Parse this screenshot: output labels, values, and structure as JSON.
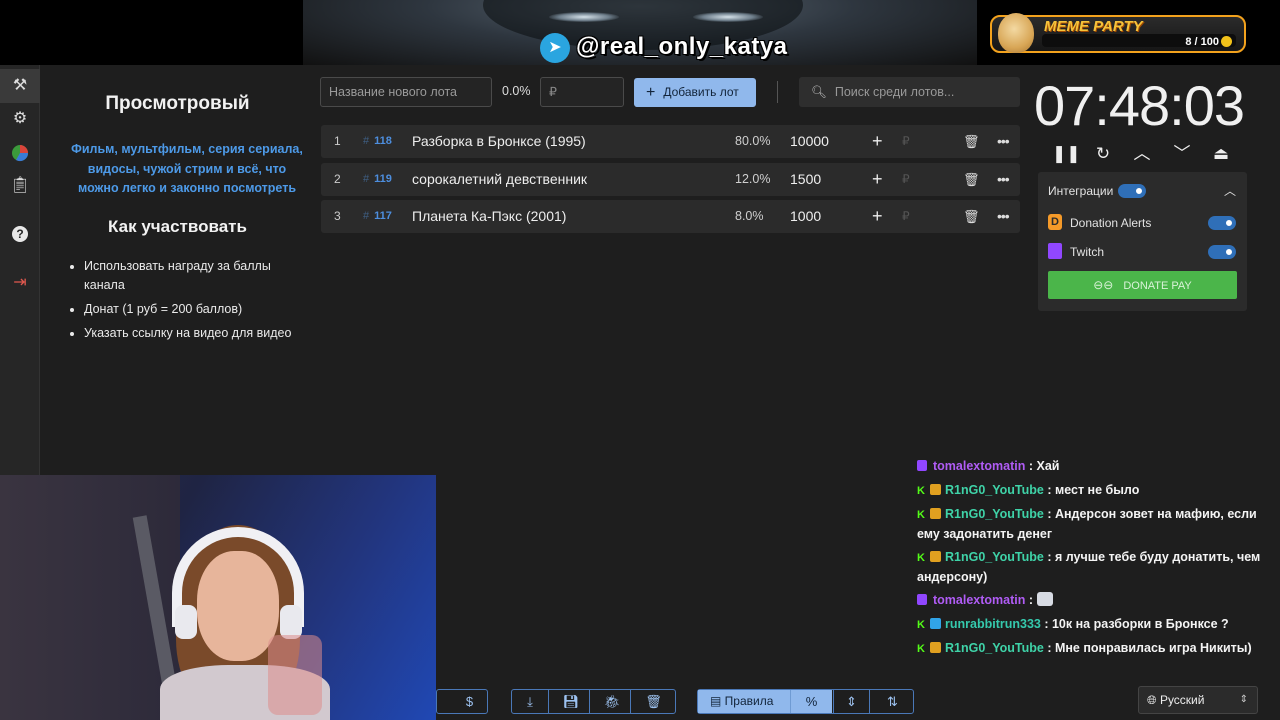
{
  "stream_overlay": {
    "telegram_handle": "@real_only_katya",
    "meme_party": {
      "title": "MEME PARTY",
      "progress_text": "8 / 100",
      "progress_value": 0.08
    }
  },
  "sidebar": {
    "icons": [
      "gavel-icon",
      "gear-icon",
      "wheel-icon",
      "clipboard-icon",
      "help-icon",
      "logout-icon"
    ],
    "active_index": 0
  },
  "info_panel": {
    "title": "Просмотровый",
    "description": "Фильм, мультфильм, серия сериала, видосы, чужой стрим и всё, что можно легко и законно посмотреть",
    "how_title": "Как участвовать",
    "bullets": [
      "Использовать награду за баллы канала",
      "Донат (1 руб = 200 баллов)",
      "Указать ссылку на видео для видео"
    ]
  },
  "toolbar": {
    "lot_name_placeholder": "Название нового лота",
    "percent": "0.0%",
    "amount_placeholder": "₽",
    "add_button": "Добавить лот",
    "search_placeholder": "Поиск среди лотов..."
  },
  "lots": [
    {
      "index": "1",
      "id": "118",
      "name": "Разборка в Бронксе (1995)",
      "percent": "80.0%",
      "amount": "10000"
    },
    {
      "index": "2",
      "id": "119",
      "name": "сорокалетний девственник",
      "percent": "12.0%",
      "amount": "1500"
    },
    {
      "index": "3",
      "id": "117",
      "name": "Планета Ка-Пэкс (2001)",
      "percent": "8.0%",
      "amount": "1000"
    }
  ],
  "timer": {
    "value": "07:48:03"
  },
  "integrations": {
    "label": "Интеграции",
    "enabled": true,
    "items": [
      {
        "name": "Donation Alerts",
        "enabled": true
      },
      {
        "name": "Twitch",
        "enabled": true
      }
    ],
    "donate_pay": "DONATE PAY"
  },
  "chat": [
    {
      "platform": "twitch",
      "user": "tomalextomatin",
      "text": "Хай"
    },
    {
      "platform": "kick",
      "user": "R1nG0_YouTube",
      "text": "мест не было"
    },
    {
      "platform": "kick",
      "user": "R1nG0_YouTube",
      "text": "Андерсон зовет на мафию, если ему задонатить денег"
    },
    {
      "platform": "kick",
      "user": "R1nG0_YouTube",
      "text": "я лучше тебе буду донатить, чем андерсону)"
    },
    {
      "platform": "twitch",
      "user": "tomalextomatin",
      "text": ""
    },
    {
      "platform": "kick",
      "user": "runrabbitrun333",
      "text": "10к на разборки в Бронксе ?"
    },
    {
      "platform": "kick",
      "user": "R1nG0_YouTube",
      "text": "Мне понравилась игра Никиты)"
    }
  ],
  "bottom_bar": {
    "rules_label": "Правила",
    "percent_label": "%",
    "language": "Русский"
  },
  "colors": {
    "accent": "#90b8ec",
    "background": "#1e1e1e",
    "panel": "#2b2b2b",
    "link": "#4d9ae8",
    "success": "#4bb54a",
    "twitch": "#9147ff"
  }
}
